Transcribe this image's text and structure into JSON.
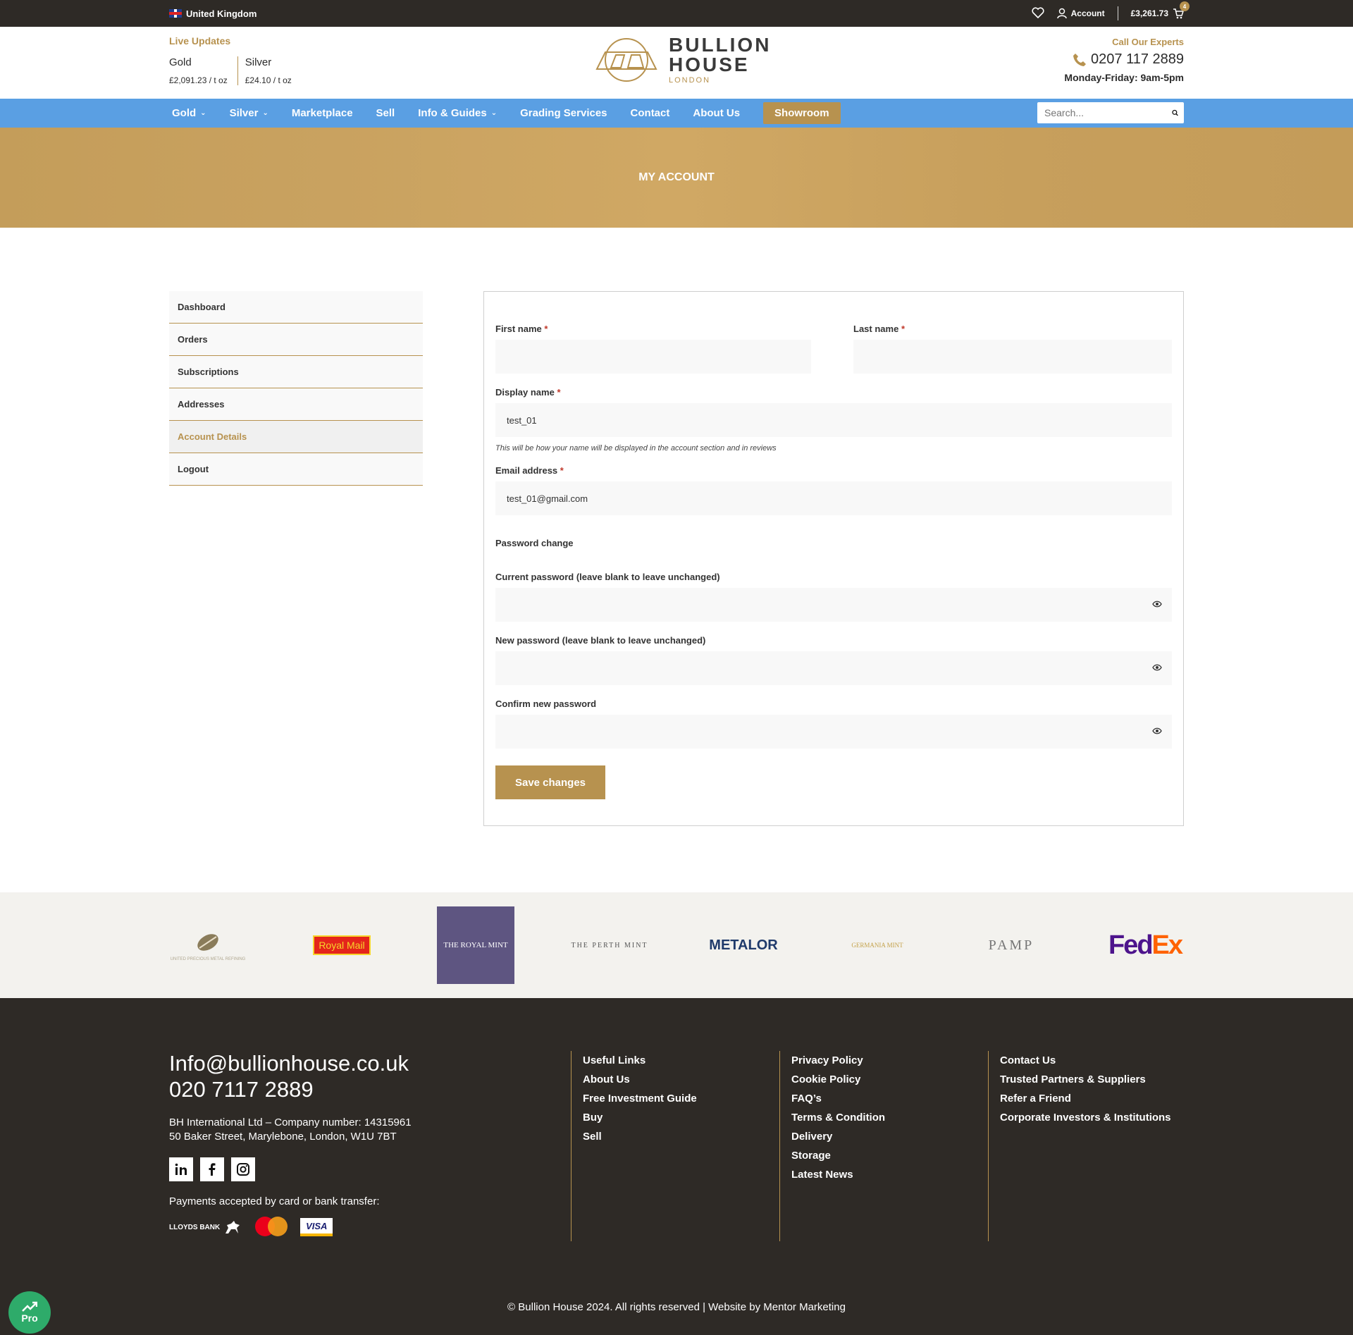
{
  "topbar": {
    "region": "United Kingdom",
    "account_label": "Account",
    "cart_total": "£3,261.73",
    "cart_count": "4"
  },
  "header": {
    "live_updates": "Live Updates",
    "gold_label": "Gold",
    "gold_price": "£2,091.23 / t oz",
    "silver_label": "Silver",
    "silver_price": "£24.10 / t oz",
    "logo_line1": "BULLION",
    "logo_line2": "HOUSE",
    "logo_sub": "LONDON",
    "call_label": "Call Our Experts",
    "phone": "0207 117 2889",
    "hours": "Monday-Friday: 9am-5pm"
  },
  "nav": {
    "gold": "Gold",
    "silver": "Silver",
    "marketplace": "Marketplace",
    "sell": "Sell",
    "info_guides": "Info & Guides",
    "grading": "Grading Services",
    "contact": "Contact",
    "about": "About Us",
    "showroom": "Showroom",
    "search_placeholder": "Search..."
  },
  "hero": {
    "title": "MY ACCOUNT"
  },
  "sidebar": {
    "items": [
      {
        "label": "Dashboard"
      },
      {
        "label": "Orders"
      },
      {
        "label": "Subscriptions"
      },
      {
        "label": "Addresses"
      },
      {
        "label": "Account Details"
      },
      {
        "label": "Logout"
      }
    ]
  },
  "form": {
    "first_name_label": "First name",
    "last_name_label": "Last name",
    "display_name_label": "Display name",
    "display_name_value": "test_01",
    "display_hint": "This will be how your name will be displayed in the account section and in reviews",
    "email_label": "Email address",
    "email_value": "test_01@gmail.com",
    "password_change": "Password change",
    "current_password_label": "Current password (leave blank to leave unchanged)",
    "new_password_label": "New password (leave blank to leave unchanged)",
    "confirm_password_label": "Confirm new password",
    "required_mark": "*",
    "save_label": "Save changes"
  },
  "partners": [
    {
      "name": "UNITED PRECIOUS METAL REFINING"
    },
    {
      "name": "Royal Mail"
    },
    {
      "name": "THE ROYAL MINT"
    },
    {
      "name": "THE PERTH MINT"
    },
    {
      "name": "METALOR"
    },
    {
      "name": "GERMANIA MINT"
    },
    {
      "name": "PAMP"
    },
    {
      "name": "FedEx"
    }
  ],
  "footer": {
    "email": "Info@bullionhouse.co.uk",
    "phone": "020 7117 2889",
    "company_line1": "BH International Ltd – Company number: 14315961",
    "company_line2": "50 Baker Street, Marylebone, London, W1U 7BT",
    "payments_text": "Payments accepted by card or bank transfer:",
    "lloyds": "LLOYDS BANK",
    "visa": "VISA",
    "col1": [
      "Useful Links",
      "About Us",
      "Free Investment Guide",
      "Buy",
      "Sell"
    ],
    "col2": [
      "Privacy Policy",
      "Cookie Policy",
      "FAQ’s",
      "Terms & Condition",
      "Delivery",
      "Storage",
      "Latest News"
    ],
    "col3": [
      "Contact Us",
      "Trusted Partners & Suppliers",
      "Refer a Friend",
      "Corporate Investors & Institutions"
    ],
    "copyright": "© Bullion House 2024. All rights reserved | Website by Mentor Marketing",
    "pro_badge": "Pro"
  },
  "colors": {
    "gold": "#b7924f",
    "nav_blue": "#5a9fe3",
    "dark": "#2e2a26"
  }
}
